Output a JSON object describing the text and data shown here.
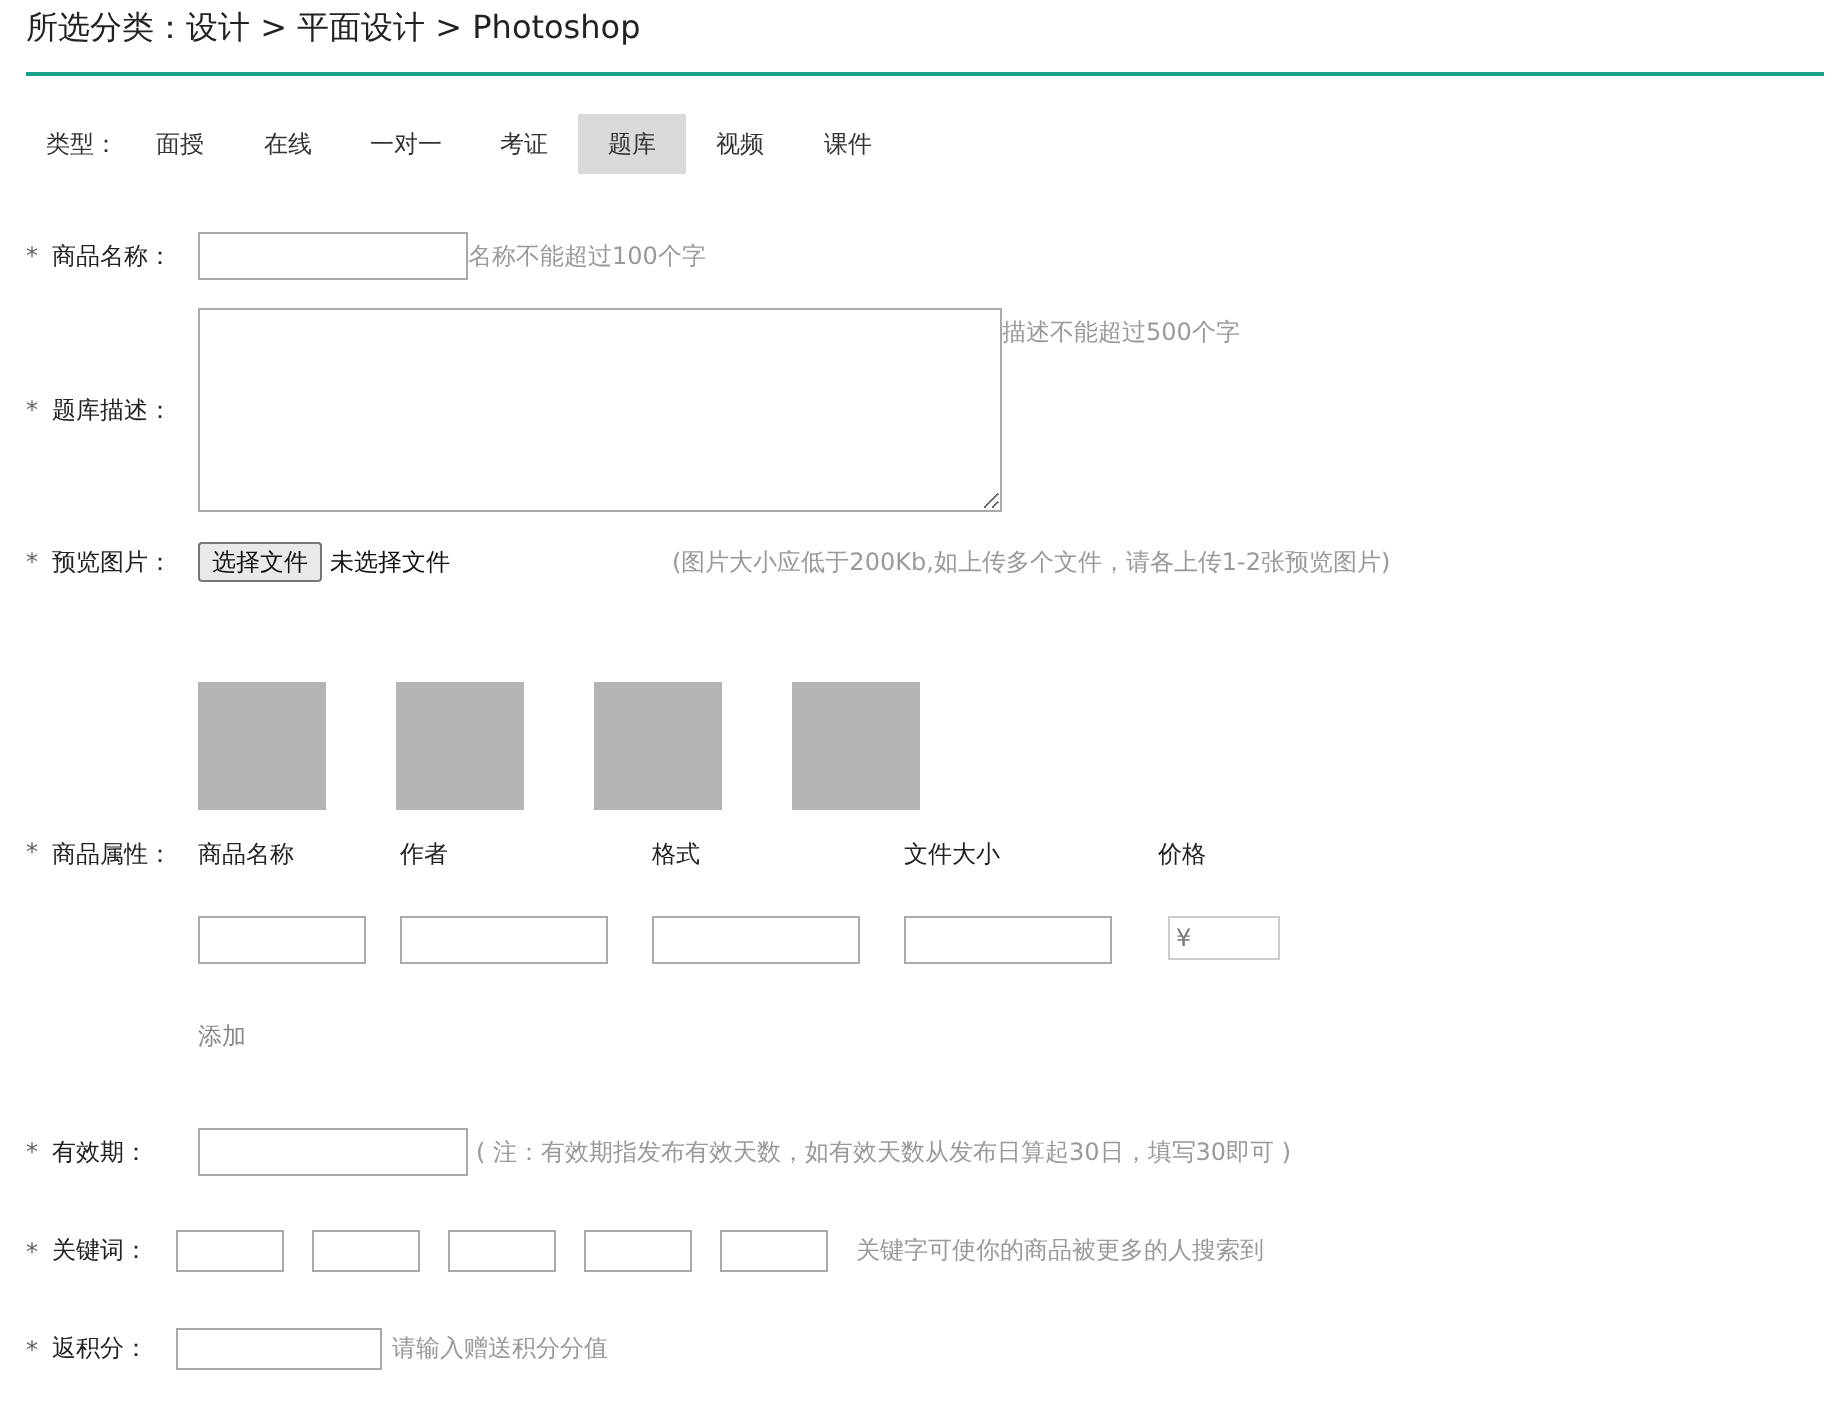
{
  "breadcrumb": "所选分类：设计 > 平面设计 > Photoshop",
  "type_filter": {
    "label": "类型：",
    "tabs": [
      {
        "label": "面授",
        "selected": false
      },
      {
        "label": "在线",
        "selected": false
      },
      {
        "label": "一对一",
        "selected": false
      },
      {
        "label": "考证",
        "selected": false
      },
      {
        "label": "题库",
        "selected": true
      },
      {
        "label": "视频",
        "selected": false
      },
      {
        "label": "课件",
        "selected": false
      }
    ]
  },
  "product_name": {
    "marker": "*",
    "label": "商品名称：",
    "hint": "名称不能超过100个字"
  },
  "description": {
    "marker": "*",
    "label": "题库描述：",
    "hint": "描述不能超过500个字"
  },
  "preview": {
    "marker": "*",
    "label": "预览图片：",
    "file_button": "选择文件",
    "file_status": "未选择文件",
    "hint": "(图片大小应低于200Kb,如上传多个文件，请各上传1-2张预览图片)",
    "thumbnails": [
      {
        "kind": "blank"
      },
      {
        "kind": "blank"
      },
      {
        "kind": "blank"
      },
      {
        "kind": "blank"
      }
    ]
  },
  "attributes": {
    "marker": "*",
    "label": "商品属性：",
    "columns": [
      {
        "heading": "商品名称",
        "kind": "text"
      },
      {
        "heading": "作者",
        "kind": "text"
      },
      {
        "heading": "格式",
        "kind": "text"
      },
      {
        "heading": "文件大小",
        "kind": "text"
      },
      {
        "heading": "价格",
        "kind": "price",
        "prefix": "¥"
      }
    ],
    "add_link": "添加"
  },
  "validity": {
    "marker": "*",
    "label": "有效期：",
    "hint": "( 注：有效期指发布有效天数，如有效天数从发布日算起30日，填写30即可 )"
  },
  "keywords": {
    "marker": "*",
    "label": "关键词：",
    "fields": [
      {
        "kind": "text"
      },
      {
        "kind": "text"
      },
      {
        "kind": "text"
      },
      {
        "kind": "text"
      },
      {
        "kind": "text"
      }
    ],
    "hint": "关键字可使你的商品被更多的人搜索到"
  },
  "points": {
    "marker": "*",
    "label": "返积分：",
    "hint": "请输入赠送积分分值"
  }
}
